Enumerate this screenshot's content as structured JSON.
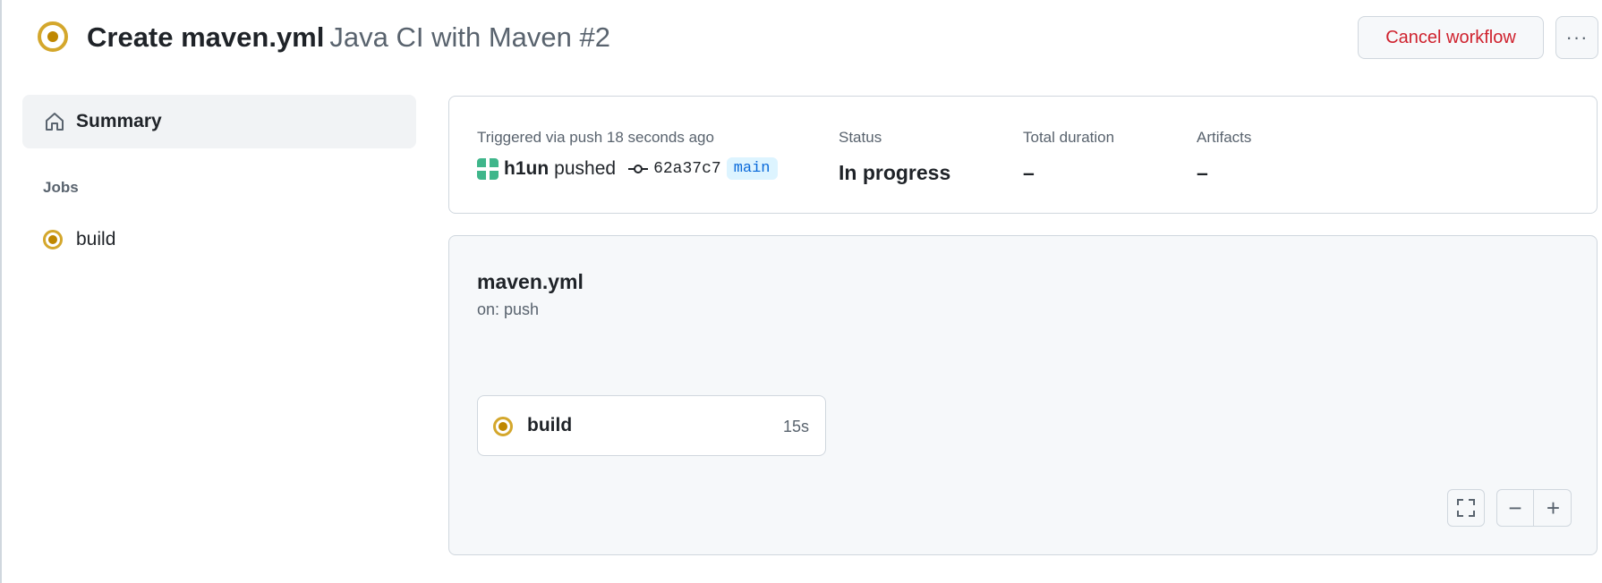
{
  "header": {
    "title": "Create maven.yml",
    "subtitle": "Java CI with Maven #2",
    "status_icon": "in-progress-icon",
    "cancel_label": "Cancel workflow",
    "more_label": "···"
  },
  "sidebar": {
    "summary_label": "Summary",
    "jobs_heading": "Jobs",
    "jobs": [
      {
        "label": "build",
        "status": "in-progress"
      }
    ]
  },
  "run_info": {
    "trigger_label": "Triggered via push 18 seconds ago",
    "actor": "h1un",
    "action": "pushed",
    "commit_sha": "62a37c7",
    "branch": "main",
    "status_label": "Status",
    "status_value": "In progress",
    "duration_label": "Total duration",
    "duration_value": "–",
    "artifacts_label": "Artifacts",
    "artifacts_value": "–"
  },
  "graph": {
    "workflow_file": "maven.yml",
    "trigger": "on: push",
    "job": {
      "name": "build",
      "duration": "15s"
    },
    "zoom_out_label": "−",
    "zoom_in_label": "+"
  },
  "colors": {
    "in_progress": "#d4a72c",
    "danger": "#cf222e",
    "accent": "#0969da"
  }
}
